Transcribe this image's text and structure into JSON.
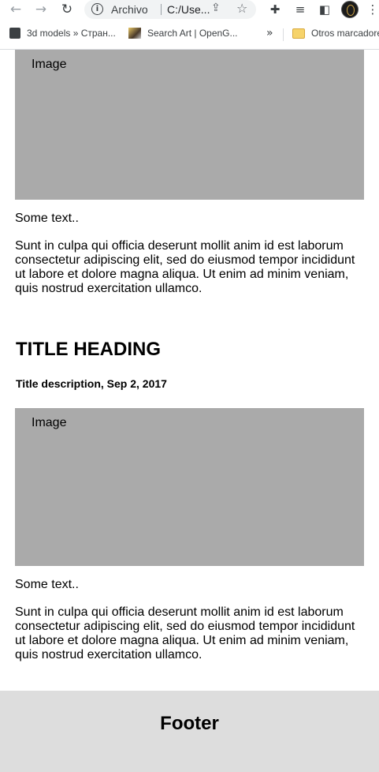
{
  "browser": {
    "omnibox": {
      "scheme_label": "Archivo",
      "path": "C:/Use..."
    },
    "bookmarks": [
      {
        "label": "3d models » Стран..."
      },
      {
        "label": "Search Art | OpenG..."
      },
      {
        "label": "Otros marcadores"
      }
    ],
    "overflow_label": "»"
  },
  "page": {
    "article1": {
      "image_label": "Image",
      "caption": "Some text..",
      "body": "Sunt in culpa qui officia deserunt mollit anim id est laborum consectetur adipiscing elit, sed do eiusmod tempor incididunt ut labore et dolore magna aliqua. Ut enim ad minim veniam, quis nostrud exercitation ullamco."
    },
    "article2": {
      "title": "TITLE HEADING",
      "description": "Title description, Sep 2, 2017",
      "image_label": "Image",
      "caption": "Some text..",
      "body": "Sunt in culpa qui officia deserunt mollit anim id est laborum consectetur adipiscing elit, sed do eiusmod tempor incididunt ut labore et dolore magna aliqua. Ut enim ad minim veniam, quis nostrud exercitation ullamco."
    },
    "footer": {
      "title": "Footer"
    }
  }
}
